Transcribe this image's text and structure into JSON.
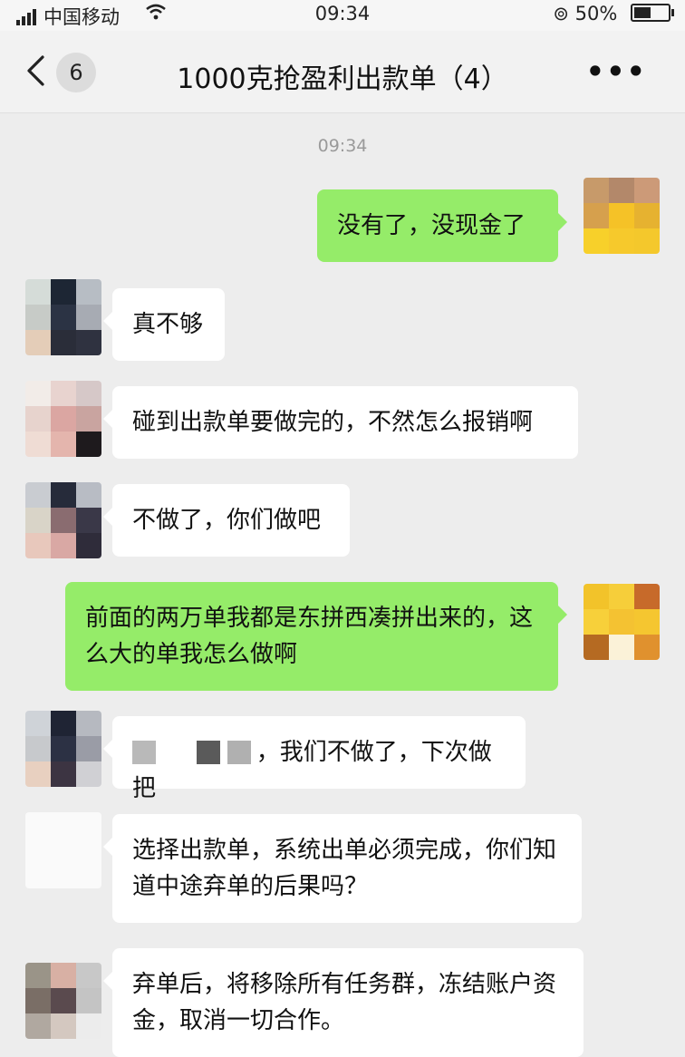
{
  "status_bar": {
    "carrier": "中国移动",
    "time": "09:34",
    "battery": "50%"
  },
  "nav": {
    "back_icon": "‹",
    "unread_count": "6",
    "title": "1000克抢盈利出款单（4）",
    "more_icon": "•••"
  },
  "chat": {
    "timestamp": "09:34",
    "messages": [
      {
        "side": "right",
        "text": "没有了，没现金了"
      },
      {
        "side": "left",
        "text": "真不够"
      },
      {
        "side": "left",
        "text": "碰到出款单要做完的，不然怎么报销啊"
      },
      {
        "side": "left",
        "text": "不做了，你们做吧"
      },
      {
        "side": "right",
        "text": "前面的两万单我都是东拼西凑拼出来的，这么大的单我怎么做啊"
      },
      {
        "side": "left",
        "text": "，我们不做了，下次做把"
      },
      {
        "side": "left",
        "text": "选择出款单，系统出单必须完成，你们知道中途弃单的后果吗？"
      },
      {
        "side": "left",
        "text": "弃单后，将移除所有任务群，冻结账户资金，取消一切合作。"
      }
    ]
  },
  "colors": {
    "background": "#ededed",
    "bubble_self": "#95ec69",
    "bubble_other": "#ffffff"
  }
}
